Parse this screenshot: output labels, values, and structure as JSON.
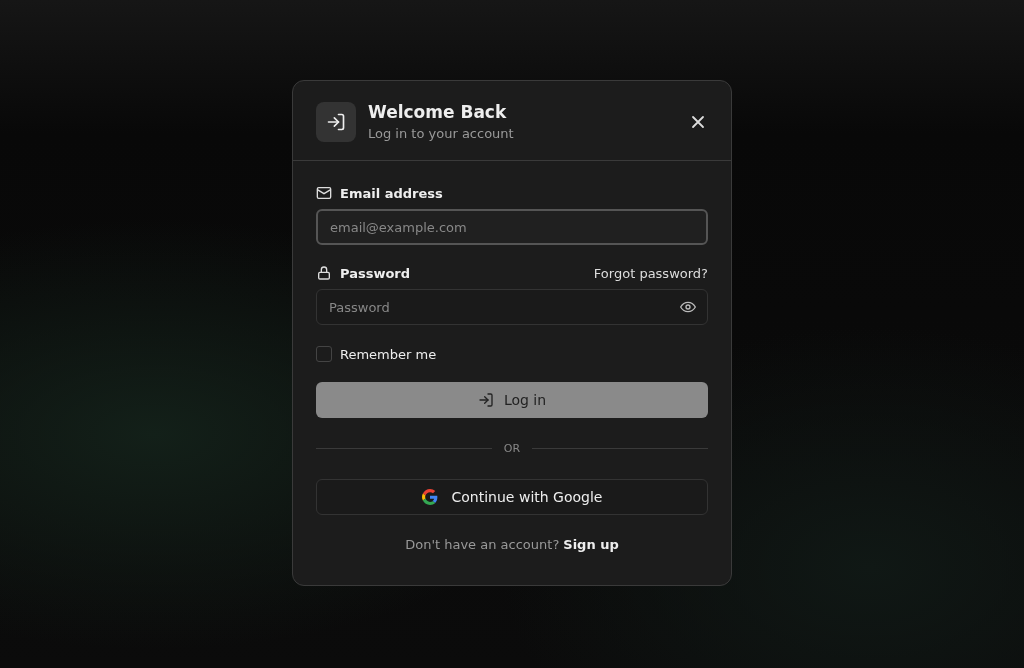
{
  "dialog": {
    "title": "Welcome Back",
    "subtitle": "Log in to your account"
  },
  "email": {
    "label": "Email address",
    "placeholder": "email@example.com",
    "focused": true
  },
  "password": {
    "label": "Password",
    "placeholder": "Password",
    "forgot_link": "Forgot password?"
  },
  "remember": {
    "label": "Remember me",
    "checked": false
  },
  "login_button": {
    "label": "Log in",
    "disabled": true
  },
  "divider_text": "OR",
  "google_button": {
    "label": "Continue with Google"
  },
  "footer": {
    "text": "Don't have an account?",
    "link": "Sign up"
  }
}
